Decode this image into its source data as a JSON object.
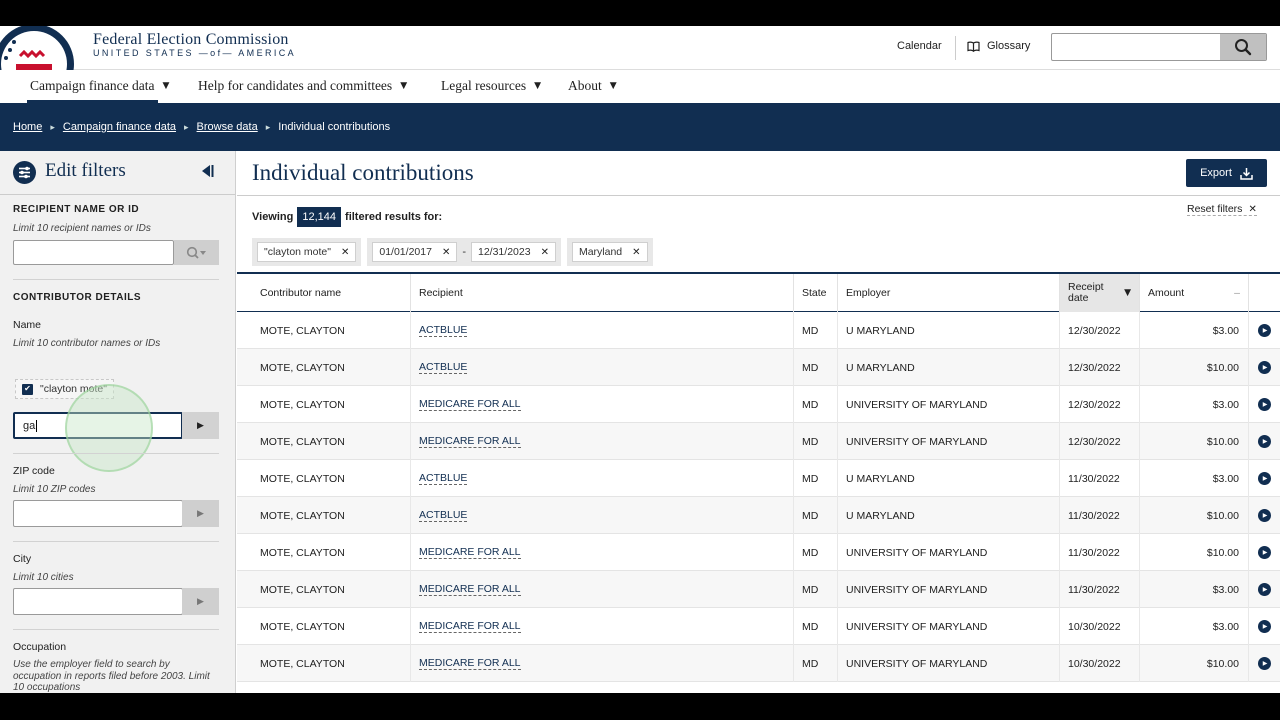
{
  "header": {
    "brand_title": "Federal Election Commission",
    "brand_subtitle": "UNITED STATES —of— AMERICA",
    "calendar": "Calendar",
    "glossary": "Glossary",
    "search_placeholder": ""
  },
  "nav": {
    "items": [
      {
        "label": "Campaign finance data"
      },
      {
        "label": "Help for candidates and committees"
      },
      {
        "label": "Legal resources"
      },
      {
        "label": "About"
      }
    ]
  },
  "breadcrumb": [
    "Home",
    "Campaign finance data",
    "Browse data",
    "Individual contributions"
  ],
  "sidebar": {
    "title": "Edit filters",
    "recipient": {
      "section": "RECIPIENT NAME OR ID",
      "hint": "Limit 10 recipient names or IDs",
      "value": ""
    },
    "contributor": {
      "section": "CONTRIBUTOR DETAILS",
      "name_label": "Name",
      "name_hint": "Limit 10 contributor names or IDs",
      "checked_name": "\"clayton mote\"",
      "name_input": "ga",
      "zip_label": "ZIP code",
      "zip_hint": "Limit 10 ZIP codes",
      "city_label": "City",
      "city_hint": "Limit 10 cities",
      "occupation_label": "Occupation",
      "occupation_hint": "Use the employer field to search by occupation in reports filed before 2003. Limit 10 occupations"
    }
  },
  "main": {
    "title": "Individual contributions",
    "export": "Export",
    "viewing_prefix": "Viewing",
    "result_count": "12,144",
    "viewing_suffix": "filtered results for:",
    "reset_filters": "Reset filters",
    "tags": {
      "name": "\"clayton mote\"",
      "date_from": "01/01/2017",
      "date_sep": "-",
      "date_to": "12/31/2023",
      "state": "Maryland"
    },
    "columns": {
      "contributor": "Contributor name",
      "recipient": "Recipient",
      "state": "State",
      "employer": "Employer",
      "receipt_date": "Receipt date",
      "amount": "Amount"
    },
    "rows": [
      {
        "name": "MOTE, CLAYTON",
        "recipient": "ACTBLUE",
        "state": "MD",
        "employer": "U MARYLAND",
        "date": "12/30/2022",
        "amount": "$3.00"
      },
      {
        "name": "MOTE, CLAYTON",
        "recipient": "ACTBLUE",
        "state": "MD",
        "employer": "U MARYLAND",
        "date": "12/30/2022",
        "amount": "$10.00"
      },
      {
        "name": "MOTE, CLAYTON",
        "recipient": "MEDICARE FOR ALL",
        "state": "MD",
        "employer": "UNIVERSITY OF MARYLAND",
        "date": "12/30/2022",
        "amount": "$3.00"
      },
      {
        "name": "MOTE, CLAYTON",
        "recipient": "MEDICARE FOR ALL",
        "state": "MD",
        "employer": "UNIVERSITY OF MARYLAND",
        "date": "12/30/2022",
        "amount": "$10.00"
      },
      {
        "name": "MOTE, CLAYTON",
        "recipient": "ACTBLUE",
        "state": "MD",
        "employer": "U MARYLAND",
        "date": "11/30/2022",
        "amount": "$3.00"
      },
      {
        "name": "MOTE, CLAYTON",
        "recipient": "ACTBLUE",
        "state": "MD",
        "employer": "U MARYLAND",
        "date": "11/30/2022",
        "amount": "$10.00"
      },
      {
        "name": "MOTE, CLAYTON",
        "recipient": "MEDICARE FOR ALL",
        "state": "MD",
        "employer": "UNIVERSITY OF MARYLAND",
        "date": "11/30/2022",
        "amount": "$10.00"
      },
      {
        "name": "MOTE, CLAYTON",
        "recipient": "MEDICARE FOR ALL",
        "state": "MD",
        "employer": "UNIVERSITY OF MARYLAND",
        "date": "11/30/2022",
        "amount": "$3.00"
      },
      {
        "name": "MOTE, CLAYTON",
        "recipient": "MEDICARE FOR ALL",
        "state": "MD",
        "employer": "UNIVERSITY OF MARYLAND",
        "date": "10/30/2022",
        "amount": "$3.00"
      },
      {
        "name": "MOTE, CLAYTON",
        "recipient": "MEDICARE FOR ALL",
        "state": "MD",
        "employer": "UNIVERSITY OF MARYLAND",
        "date": "10/30/2022",
        "amount": "$10.00"
      }
    ]
  },
  "colors": {
    "navy": "#112e51",
    "seal_red": "#c8102e"
  },
  "icons": [
    "seal-logo",
    "book-icon",
    "search-icon",
    "filter-icon",
    "collapse-left-icon",
    "chevron-down-icon",
    "play-icon",
    "close-icon",
    "download-icon",
    "sort-desc-icon"
  ]
}
